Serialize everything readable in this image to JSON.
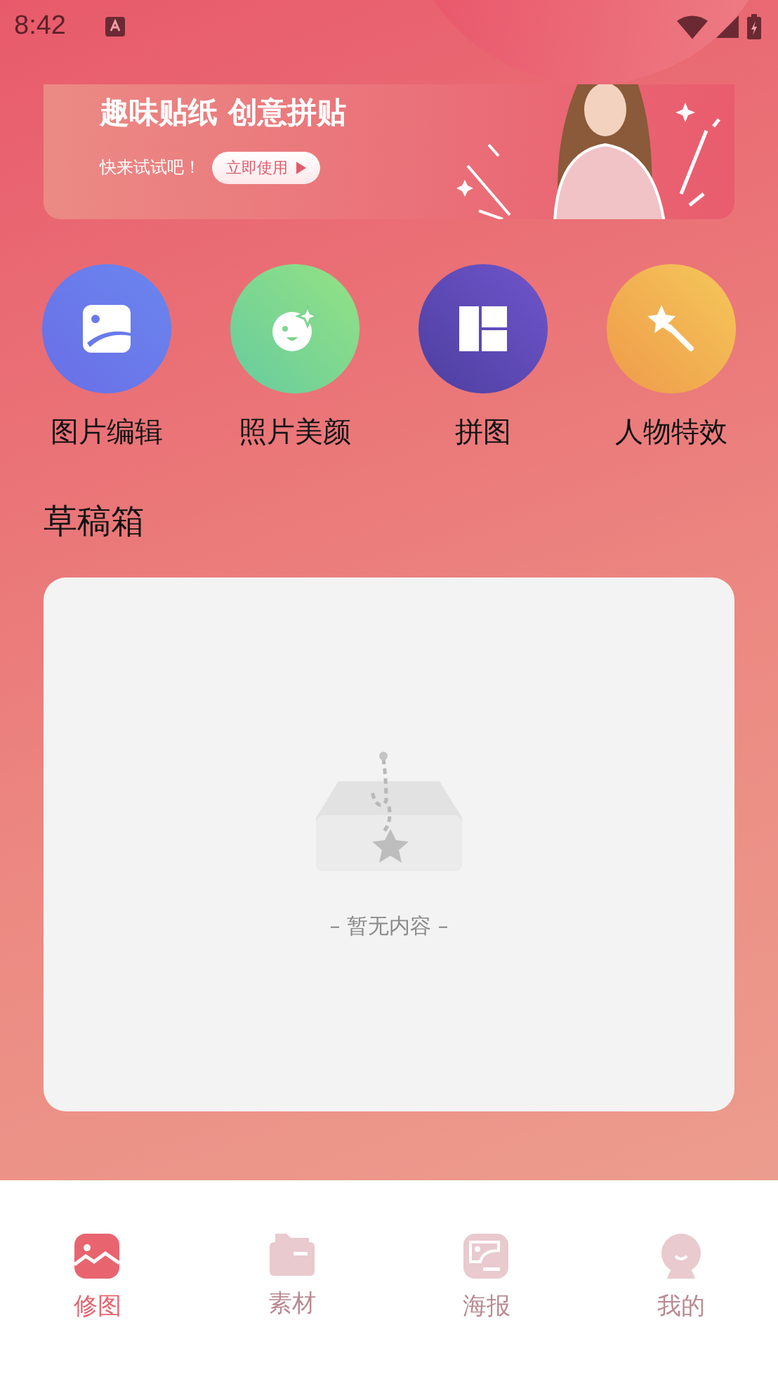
{
  "status_bar": {
    "time": "8:42"
  },
  "banner": {
    "title": "趣味贴纸 创意拼贴",
    "subtitle": "快来试试吧！",
    "button": "立即使用"
  },
  "features": [
    {
      "kind": "edit",
      "label": "图片编辑"
    },
    {
      "kind": "beauty",
      "label": "照片美颜"
    },
    {
      "kind": "collage",
      "label": "拼图"
    },
    {
      "kind": "effects",
      "label": "人物特效"
    }
  ],
  "drafts": {
    "title": "草稿箱",
    "empty_text": "– 暂无内容 –"
  },
  "tabs": [
    {
      "kind": "edit",
      "label": "修图",
      "selected": true
    },
    {
      "kind": "material",
      "label": "素材",
      "selected": false
    },
    {
      "kind": "poster",
      "label": "海报",
      "selected": false
    },
    {
      "kind": "me",
      "label": "我的",
      "selected": false
    }
  ]
}
